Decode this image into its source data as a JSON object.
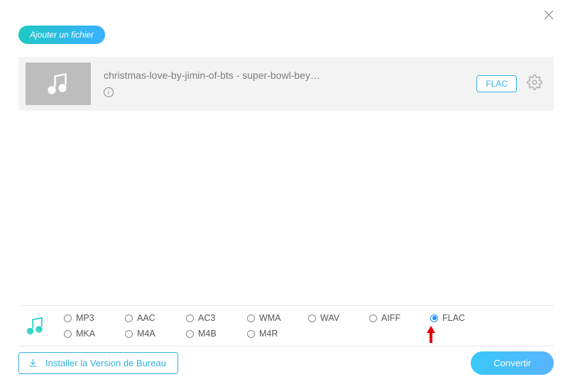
{
  "header": {
    "add_file_label": "Ajouter un fichier"
  },
  "file": {
    "title": "christmas-love-by-jimin-of-bts - super-bowl-bey…",
    "format_badge": "FLAC"
  },
  "formats": {
    "row1": [
      {
        "label": "MP3",
        "selected": false
      },
      {
        "label": "AAC",
        "selected": false
      },
      {
        "label": "AC3",
        "selected": false
      },
      {
        "label": "WMA",
        "selected": false
      },
      {
        "label": "WAV",
        "selected": false
      },
      {
        "label": "AIFF",
        "selected": false
      },
      {
        "label": "FLAC",
        "selected": true
      }
    ],
    "row2": [
      {
        "label": "MKA",
        "selected": false
      },
      {
        "label": "M4A",
        "selected": false
      },
      {
        "label": "M4B",
        "selected": false
      },
      {
        "label": "M4R",
        "selected": false
      }
    ]
  },
  "footer": {
    "install_label": "Installer la Version de Bureau",
    "convert_label": "Convertir"
  }
}
